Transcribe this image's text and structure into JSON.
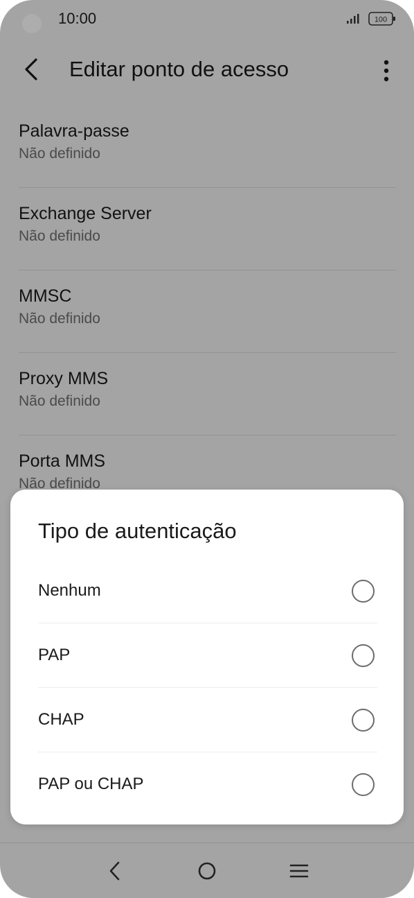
{
  "status_bar": {
    "time": "10:00",
    "battery": "100"
  },
  "app_bar": {
    "title": "Editar ponto de acesso",
    "back_icon": "chevron-left-icon",
    "more_icon": "more-vertical-icon"
  },
  "settings": [
    {
      "title": "Palavra-passe",
      "value": "Não definido"
    },
    {
      "title": "Exchange Server",
      "value": "Não definido"
    },
    {
      "title": "MMSC",
      "value": "Não definido"
    },
    {
      "title": "Proxy MMS",
      "value": "Não definido"
    },
    {
      "title": "Porta MMS",
      "value": "Não definido"
    }
  ],
  "dialog": {
    "title": "Tipo de autenticação",
    "options": [
      {
        "label": "Nenhum",
        "selected": false
      },
      {
        "label": "PAP",
        "selected": false
      },
      {
        "label": "CHAP",
        "selected": false
      },
      {
        "label": "PAP ou CHAP",
        "selected": false
      }
    ]
  },
  "nav_bar": {
    "back_icon": "nav-back-icon",
    "home_icon": "nav-home-icon",
    "recent_icon": "nav-menu-icon"
  },
  "colors": {
    "background": "#f2f2f2",
    "scrim": "#000000",
    "dialog_bg": "#ffffff",
    "radio_border": "#6b6b6b"
  }
}
